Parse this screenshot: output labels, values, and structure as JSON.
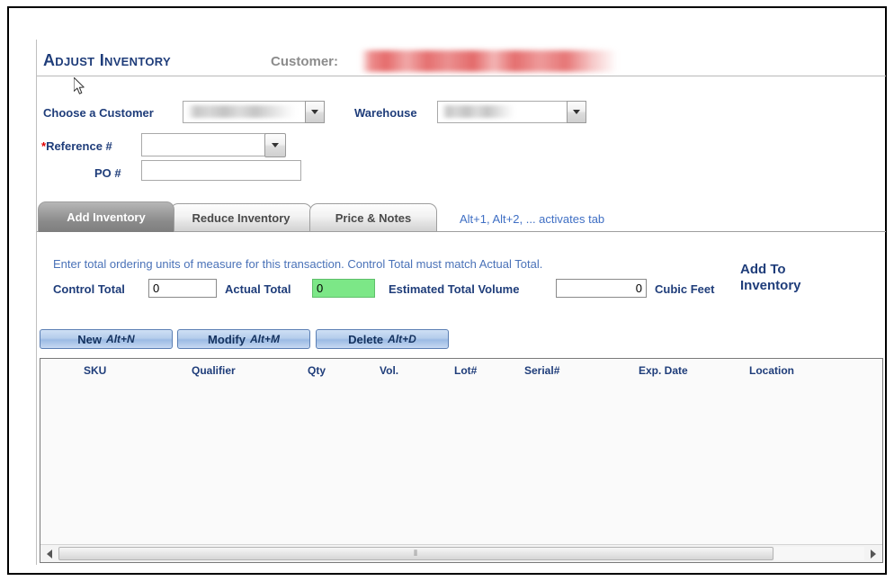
{
  "page": {
    "title": "Adjust Inventory",
    "customer_label": "Customer:",
    "customer_value": ""
  },
  "form": {
    "choose_customer_label": "Choose a Customer",
    "choose_customer_value": "",
    "warehouse_label": "Warehouse",
    "warehouse_value": "",
    "reference_required_marker": "*",
    "reference_label": "Reference #",
    "reference_value": "",
    "po_label": "PO #",
    "po_value": ""
  },
  "tabs": {
    "items": [
      {
        "label": "Add Inventory",
        "active": true
      },
      {
        "label": "Reduce Inventory",
        "active": false
      },
      {
        "label": "Price & Notes",
        "active": false
      }
    ],
    "hint": "Alt+1, Alt+2, ... activates tab"
  },
  "panel": {
    "instruction": "Enter total ordering units of measure for this transaction. Control Total must match Actual Total.",
    "control_total_label": "Control Total",
    "control_total_value": "0",
    "actual_total_label": "Actual Total",
    "actual_total_value": "0",
    "estimated_volume_label": "Estimated Total Volume",
    "estimated_volume_value": "0",
    "cubic_feet_label": "Cubic Feet",
    "add_to_inventory_line1": "Add To",
    "add_to_inventory_line2": "Inventory",
    "actual_total_bg_color": "#7ce787"
  },
  "actions": [
    {
      "label": "New",
      "shortcut": "Alt+N"
    },
    {
      "label": "Modify",
      "shortcut": "Alt+M"
    },
    {
      "label": "Delete",
      "shortcut": "Alt+D"
    }
  ],
  "grid": {
    "columns": [
      "SKU",
      "Qualifier",
      "Qty",
      "Vol.",
      "Lot#",
      "Serial#",
      "Exp. Date",
      "Location"
    ],
    "rows": [],
    "scrollbar_grip": "⫴"
  },
  "colors": {
    "heading": "#1f3d7a",
    "link_text": "#4a72b8",
    "button": "#b5cdec"
  }
}
